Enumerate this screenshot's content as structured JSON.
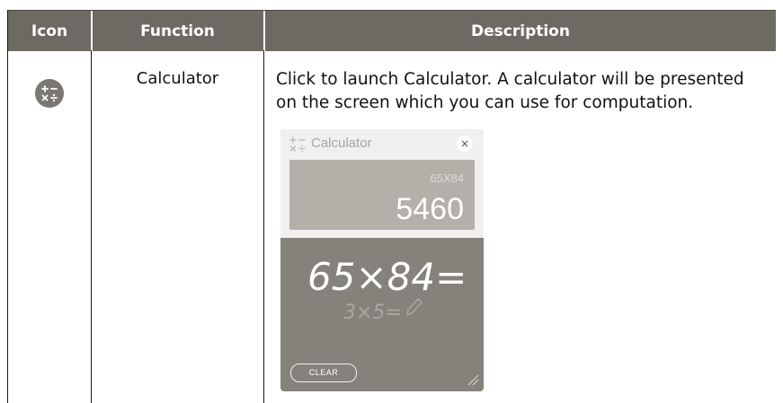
{
  "table": {
    "headers": {
      "icon": "Icon",
      "function": "Function",
      "description": "Description"
    },
    "rows": [
      {
        "icon": "calculator-icon",
        "function": "Calculator",
        "description": "Click to launch Calculator. A calculator will be presented on the screen which you can use for computation."
      }
    ]
  },
  "calculator": {
    "title": "Calculator",
    "close_label": "×",
    "expression": "65X84",
    "result": "5460",
    "handwriting_main": "65×84=",
    "handwriting_ghost": "3×5=",
    "clear_label": "CLEAR"
  },
  "colors": {
    "header_bg": "#6d6a63",
    "icon_bg": "#7b7873",
    "calc_pad_bg": "#85827b",
    "calc_display_bg": "#b3afa9"
  }
}
